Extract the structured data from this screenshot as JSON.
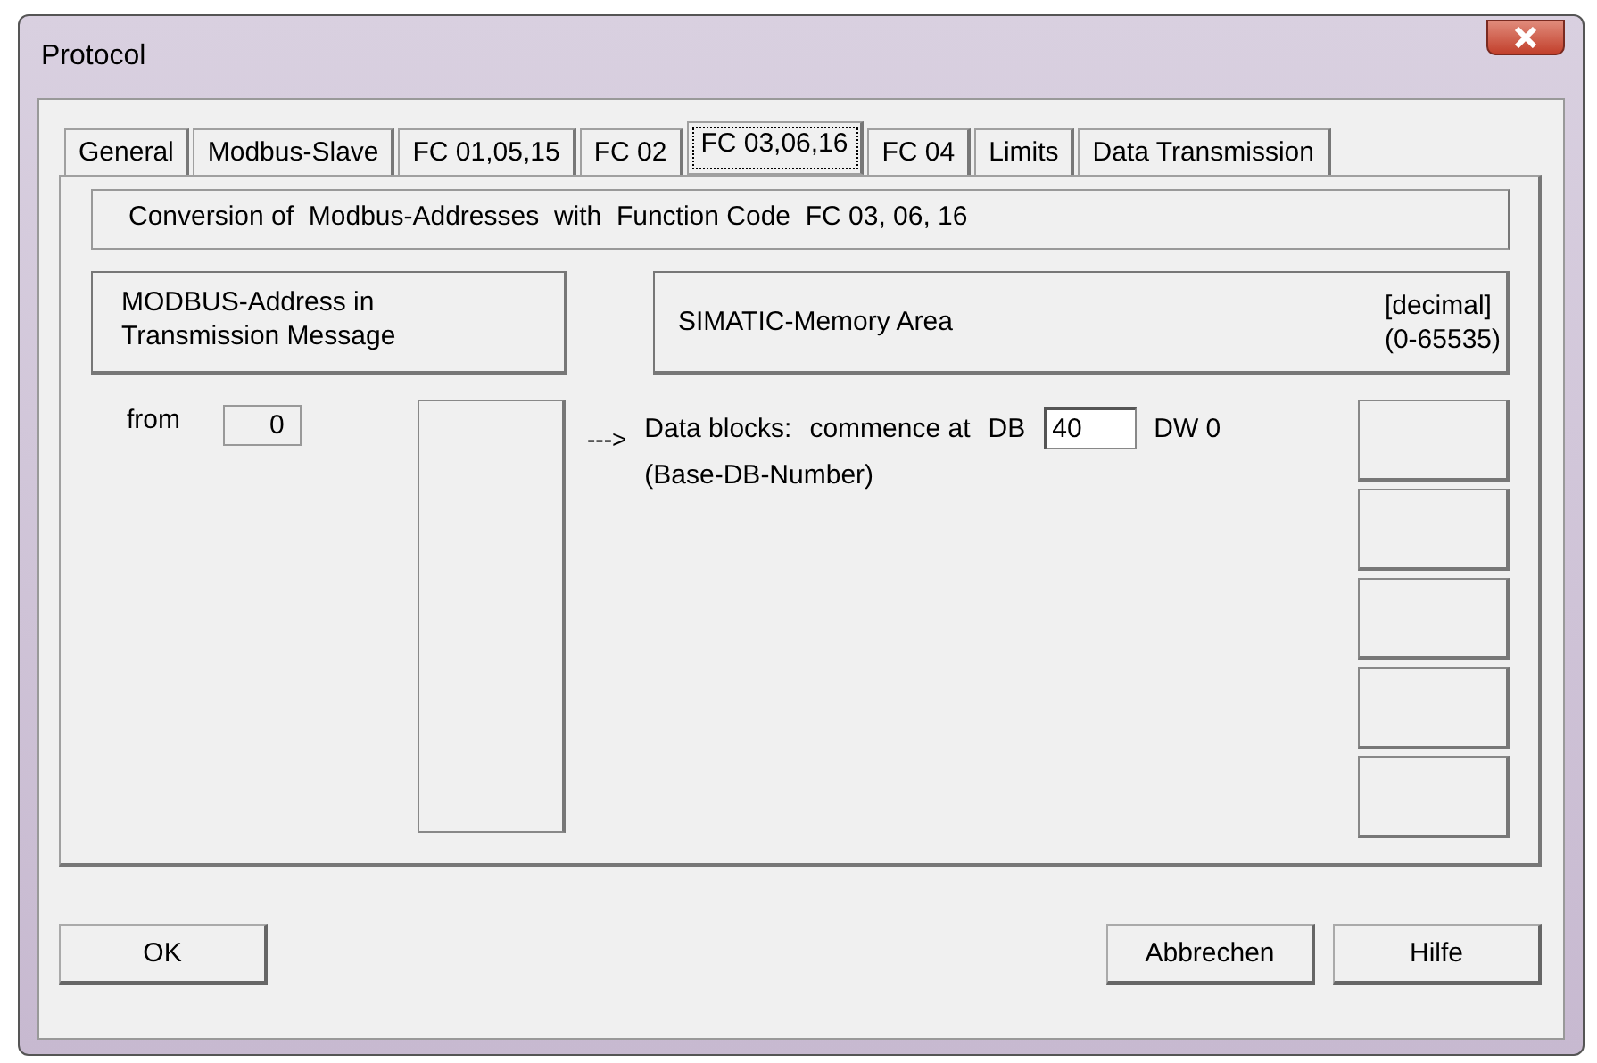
{
  "window": {
    "title": "Protocol"
  },
  "tabs": [
    {
      "label": "General",
      "selected": false
    },
    {
      "label": "Modbus-Slave",
      "selected": false
    },
    {
      "label": "FC 01,05,15",
      "selected": false
    },
    {
      "label": "FC 02",
      "selected": false
    },
    {
      "label": "FC 03,06,16",
      "selected": true
    },
    {
      "label": "FC 04",
      "selected": false
    },
    {
      "label": "Limits",
      "selected": false
    },
    {
      "label": "Data Transmission",
      "selected": false
    }
  ],
  "heading": "Conversion of  Modbus-Addresses  with  Function Code  FC 03, 06, 16",
  "modbus_header": [
    "MODBUS-Address in",
    "Transmission Message"
  ],
  "simatic_header": {
    "title": "SIMATIC-Memory Area",
    "range": [
      "[decimal]",
      "(0-65535)"
    ]
  },
  "from": {
    "label": "from",
    "value": "0"
  },
  "mapping": {
    "arrow": "--->",
    "label": "Data blocks:",
    "commence": "commence at",
    "db_label": "DB",
    "db_value": "40",
    "dw_label": "DW 0",
    "note": "(Base-DB-Number)"
  },
  "buttons": {
    "left": [
      "OK"
    ],
    "right": [
      "Abbrechen",
      "Hilfe"
    ]
  }
}
